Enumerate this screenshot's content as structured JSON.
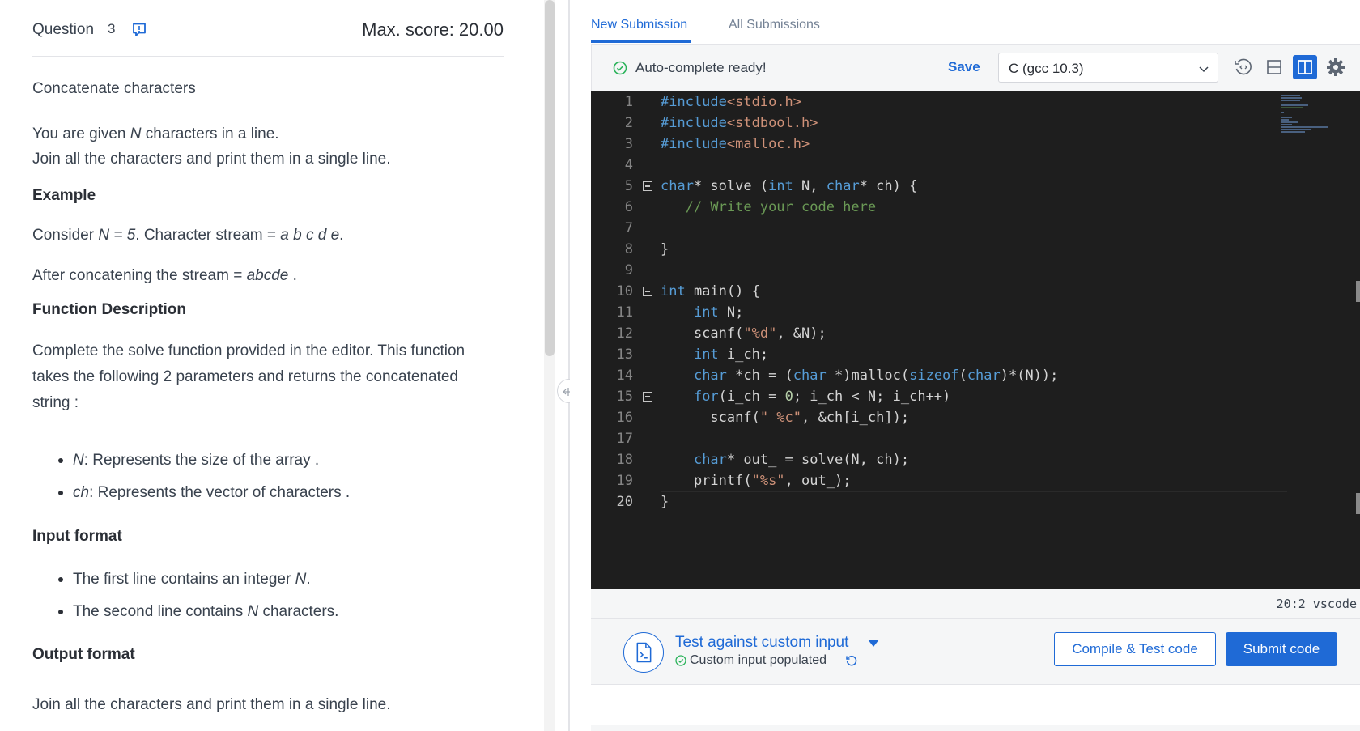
{
  "question": {
    "label": "Question",
    "number": "3",
    "max_score": "Max. score: 20.00",
    "title": "Concatenate characters",
    "intro_1_a": "You are given ",
    "intro_1_b": "N",
    "intro_1_c": " characters in a line.",
    "intro_2": "Join all the characters and print them in a single line.",
    "example_heading": "Example",
    "example_a": "Consider ",
    "example_b": "N = 5",
    "example_c": ". Character stream ",
    "example_d": " = ",
    "example_e": "a b c d e",
    "example_f": ".",
    "after_a": "After concatening the stream = ",
    "after_b": "abcde",
    "after_c": ".",
    "function_heading": "Function Description",
    "function_1": "Complete the solve function provided in the editor. This function",
    "function_2": "takes the following 2 parameters and returns the concatenated",
    "function_3": "string :",
    "param_1_name": "N",
    "param_1_desc": ": Represents the size of the array .",
    "param_2_name": "ch",
    "param_2_desc": ": Represents the vector of characters .",
    "input_heading": "Input format",
    "input_1_a": "The first line contains an integer ",
    "input_1_b": "N",
    "input_1_c": ".",
    "input_2_a": "The second line contains ",
    "input_2_b": "N",
    "input_2_c": " characters.",
    "output_heading": "Output format",
    "output_1": "Join all the characters and print them in a single line."
  },
  "tabs": [
    {
      "label": "New Submission",
      "active": true
    },
    {
      "label": "All Submissions",
      "active": false
    }
  ],
  "toolbar": {
    "status": "Auto-complete ready!",
    "save_label": "Save",
    "language": "C (gcc 10.3)"
  },
  "editor": {
    "status_bar": "20:2 vscode",
    "current_line": 20
  },
  "bottom": {
    "custom_title": "Test against custom input",
    "custom_sub": "Custom input populated",
    "compile_label": "Compile & Test code",
    "submit_label": "Submit code"
  },
  "colors": {
    "accent": "#1f6ad6",
    "editor_bg": "#1e1e1e",
    "success": "#2bb35b"
  }
}
